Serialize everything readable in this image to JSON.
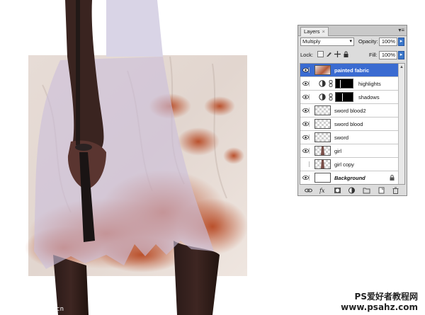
{
  "panel": {
    "tab_label": "Layers",
    "tab_close": "×",
    "menu_icon": "panel-menu-icon",
    "blend_mode": "Multiply",
    "opacity_label": "Opacity:",
    "opacity_value": "100%",
    "lock_label": "Lock:",
    "fill_label": "Fill:",
    "fill_value": "100%",
    "layers": [
      {
        "name": "painted fabric",
        "visible": true,
        "selected": true,
        "kind": "pixel-art"
      },
      {
        "name": "highlights",
        "visible": true,
        "selected": false,
        "kind": "adjustment"
      },
      {
        "name": "shadows",
        "visible": true,
        "selected": false,
        "kind": "adjustment"
      },
      {
        "name": "sword blood2",
        "visible": true,
        "selected": false,
        "kind": "pixel"
      },
      {
        "name": "sword blood",
        "visible": true,
        "selected": false,
        "kind": "pixel"
      },
      {
        "name": "sword",
        "visible": true,
        "selected": false,
        "kind": "pixel"
      },
      {
        "name": "girl",
        "visible": true,
        "selected": false,
        "kind": "figure"
      },
      {
        "name": "girl copy",
        "visible": false,
        "selected": false,
        "kind": "figure"
      },
      {
        "name": "Background",
        "visible": true,
        "selected": false,
        "kind": "background",
        "locked": true
      }
    ],
    "bottom_icons": [
      "link-icon",
      "fx-icon",
      "mask-icon",
      "adjustment-icon",
      "folder-icon",
      "new-layer-icon",
      "trash-icon"
    ],
    "colors": {
      "selected": "#3a6bd1",
      "panel": "#dcdcdc"
    }
  },
  "watermarks": {
    "left": "www.16PS.com.cn",
    "right_line1": "PS爱好者教程网",
    "right_line2": "www.psahz.com"
  }
}
